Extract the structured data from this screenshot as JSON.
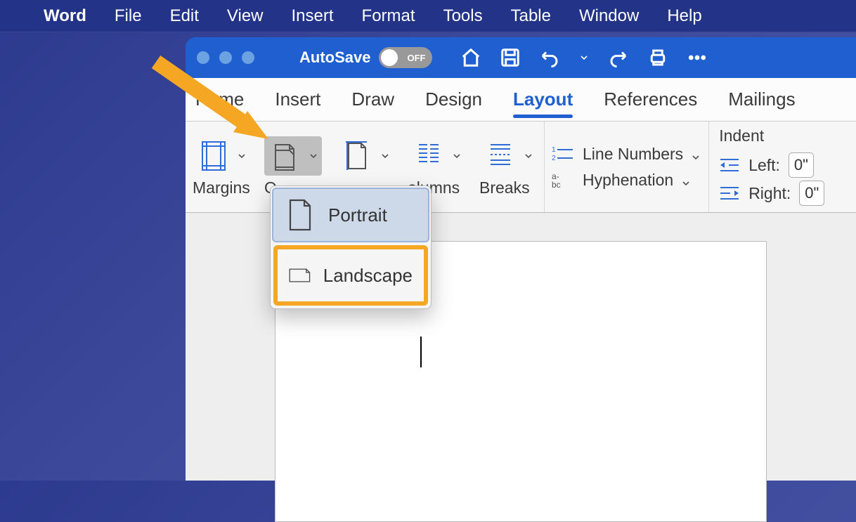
{
  "menubar": {
    "app": "Word",
    "items": [
      "File",
      "Edit",
      "View",
      "Insert",
      "Format",
      "Tools",
      "Table",
      "Window",
      "Help"
    ]
  },
  "titlebar": {
    "autosave_label": "AutoSave",
    "autosave_state": "OFF"
  },
  "ribbon_tabs": [
    "Home",
    "Insert",
    "Draw",
    "Design",
    "Layout",
    "References",
    "Mailings"
  ],
  "active_tab": "Layout",
  "layout_ribbon": {
    "margins": "Margins",
    "orientation_partial": "O",
    "columns_partial": "olumns",
    "breaks": "Breaks",
    "line_numbers": "Line Numbers",
    "hyphenation": "Hyphenation",
    "indent_title": "Indent",
    "indent_left_label": "Left:",
    "indent_left_value": "0\"",
    "indent_right_label": "Right:",
    "indent_right_value": "0\""
  },
  "orientation_menu": {
    "portrait": "Portrait",
    "landscape": "Landscape"
  }
}
